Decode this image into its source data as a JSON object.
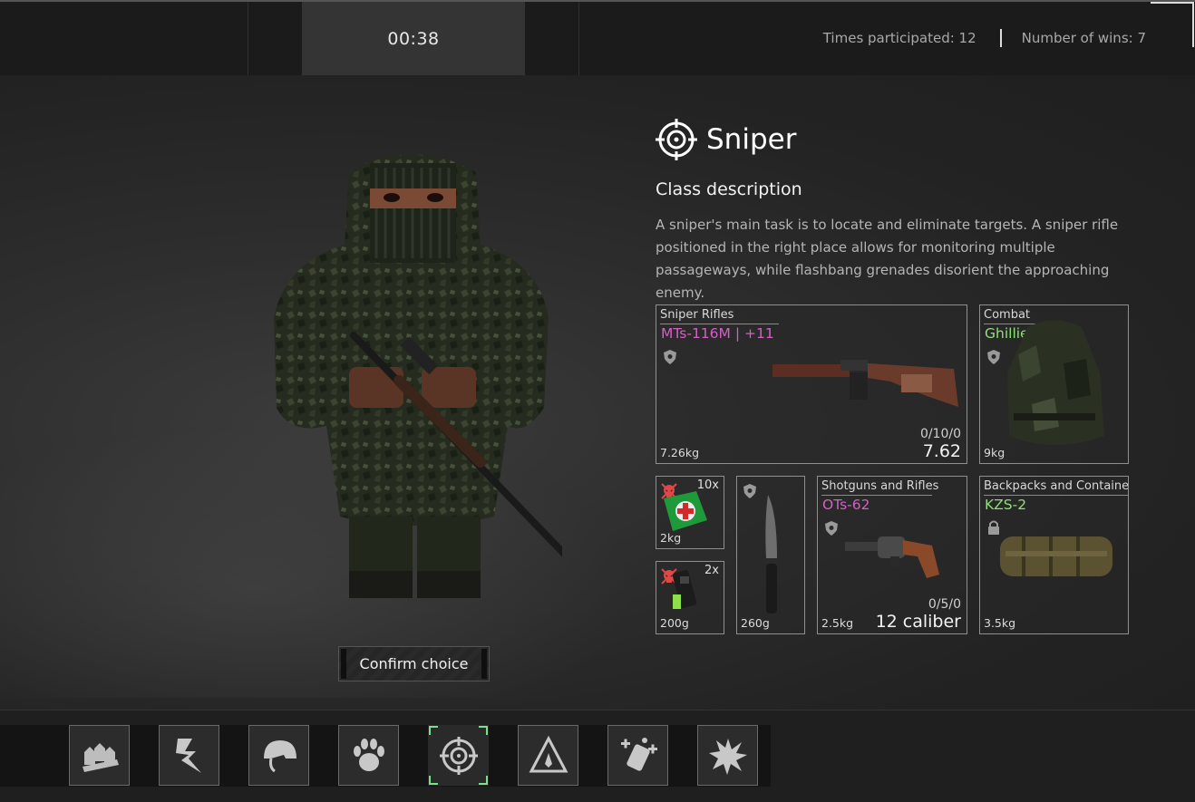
{
  "header": {
    "timer": "00:38",
    "times_participated": "Times participated: 12",
    "number_of_wins": "Number of wins: 7"
  },
  "class_info": {
    "name": "Sniper",
    "icon": "crosshair-icon",
    "description_heading": "Class description",
    "description": "A sniper's main task is to locate and eliminate targets. A sniper rifle positioned in the right place allows for monitoring multiple passageways, while flashbang grenades disorient the approaching enemy."
  },
  "confirm_label": "Confirm choice",
  "loadout": {
    "primary": {
      "category": "Sniper Rifles",
      "name": "MTs-116M | +11",
      "weight": "7.26kg",
      "ammo": "0/10/0",
      "caliber": "7.62",
      "name_color": "#d360c5"
    },
    "armor": {
      "category": "Combat",
      "name": "Ghillie Suit",
      "weight": "9kg",
      "name_color": "#8fe07a"
    },
    "medkit": {
      "count": "10x",
      "weight": "2kg"
    },
    "tourniquet": {
      "count": "2x",
      "weight": "200g"
    },
    "knife": {
      "weight": "260g"
    },
    "secondary": {
      "category": "Shotguns and Rifles",
      "name": "OTs-62",
      "weight": "2.5kg",
      "ammo": "0/5/0",
      "caliber": "12 caliber",
      "name_color": "#d360c5"
    },
    "backpack": {
      "category": "Backpacks and Containers",
      "name": "KZS-2",
      "weight": "3.5kg",
      "name_color": "#8fe07a"
    }
  },
  "class_bar": [
    {
      "icon": "ammo-belt-icon"
    },
    {
      "icon": "lightning-icon"
    },
    {
      "icon": "helmet-icon"
    },
    {
      "icon": "paw-icon"
    },
    {
      "icon": "crosshair-icon",
      "selected": true
    },
    {
      "icon": "warning-triangle-icon"
    },
    {
      "icon": "medical-supplies-icon"
    },
    {
      "icon": "explosion-icon"
    }
  ],
  "colors": {
    "accent_green": "#7be08b",
    "rarity_purple": "#d360c5",
    "rarity_green": "#8fe07a"
  }
}
